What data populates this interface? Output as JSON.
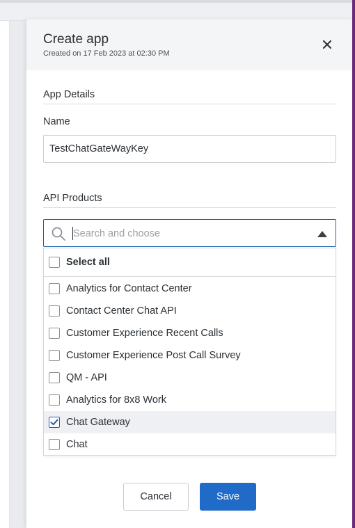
{
  "drawer": {
    "title": "Create app",
    "subtitle": "Created on 17 Feb 2023 at 02:30 PM"
  },
  "details": {
    "section_title": "App Details",
    "name_label": "Name",
    "name_value": "TestChatGateWayKey"
  },
  "products": {
    "section_title": "API Products",
    "search_placeholder": "Search and choose",
    "select_all_label": "Select all",
    "options": [
      {
        "label": "Analytics for Contact Center",
        "checked": false
      },
      {
        "label": "Contact Center Chat API",
        "checked": false
      },
      {
        "label": "Customer Experience Recent Calls",
        "checked": false
      },
      {
        "label": "Customer Experience Post Call Survey",
        "checked": false
      },
      {
        "label": "QM - API",
        "checked": false
      },
      {
        "label": "Analytics for 8x8 Work",
        "checked": false
      },
      {
        "label": "Chat Gateway",
        "checked": true
      },
      {
        "label": "Chat",
        "checked": false
      }
    ]
  },
  "actions": {
    "cancel_label": "Cancel",
    "save_label": "Save"
  },
  "colors": {
    "primary": "#1f6bc7",
    "focus_border": "#1f5fae",
    "side_accent": "#6a2a7a"
  }
}
